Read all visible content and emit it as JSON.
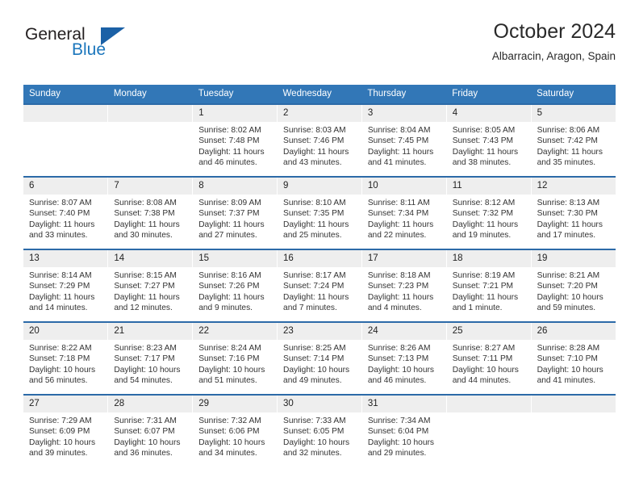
{
  "brand": {
    "name_part1": "General",
    "name_part2": "Blue",
    "accent_color": "#1b76bc",
    "triangle_color": "#1b61a6"
  },
  "header": {
    "title": "October 2024",
    "subtitle": "Albarracin, Aragon, Spain"
  },
  "theme": {
    "header_bg": "#3277b7",
    "row_rule": "#2c6aa8",
    "daynum_bg": "#eeeeee"
  },
  "weekdays": [
    "Sunday",
    "Monday",
    "Tuesday",
    "Wednesday",
    "Thursday",
    "Friday",
    "Saturday"
  ],
  "weeks": [
    [
      {
        "day": "",
        "sunrise": "",
        "sunset": "",
        "daylight": "",
        "empty": true
      },
      {
        "day": "",
        "sunrise": "",
        "sunset": "",
        "daylight": "",
        "empty": true
      },
      {
        "day": "1",
        "sunrise": "Sunrise: 8:02 AM",
        "sunset": "Sunset: 7:48 PM",
        "daylight": "Daylight: 11 hours and 46 minutes."
      },
      {
        "day": "2",
        "sunrise": "Sunrise: 8:03 AM",
        "sunset": "Sunset: 7:46 PM",
        "daylight": "Daylight: 11 hours and 43 minutes."
      },
      {
        "day": "3",
        "sunrise": "Sunrise: 8:04 AM",
        "sunset": "Sunset: 7:45 PM",
        "daylight": "Daylight: 11 hours and 41 minutes."
      },
      {
        "day": "4",
        "sunrise": "Sunrise: 8:05 AM",
        "sunset": "Sunset: 7:43 PM",
        "daylight": "Daylight: 11 hours and 38 minutes."
      },
      {
        "day": "5",
        "sunrise": "Sunrise: 8:06 AM",
        "sunset": "Sunset: 7:42 PM",
        "daylight": "Daylight: 11 hours and 35 minutes."
      }
    ],
    [
      {
        "day": "6",
        "sunrise": "Sunrise: 8:07 AM",
        "sunset": "Sunset: 7:40 PM",
        "daylight": "Daylight: 11 hours and 33 minutes."
      },
      {
        "day": "7",
        "sunrise": "Sunrise: 8:08 AM",
        "sunset": "Sunset: 7:38 PM",
        "daylight": "Daylight: 11 hours and 30 minutes."
      },
      {
        "day": "8",
        "sunrise": "Sunrise: 8:09 AM",
        "sunset": "Sunset: 7:37 PM",
        "daylight": "Daylight: 11 hours and 27 minutes."
      },
      {
        "day": "9",
        "sunrise": "Sunrise: 8:10 AM",
        "sunset": "Sunset: 7:35 PM",
        "daylight": "Daylight: 11 hours and 25 minutes."
      },
      {
        "day": "10",
        "sunrise": "Sunrise: 8:11 AM",
        "sunset": "Sunset: 7:34 PM",
        "daylight": "Daylight: 11 hours and 22 minutes."
      },
      {
        "day": "11",
        "sunrise": "Sunrise: 8:12 AM",
        "sunset": "Sunset: 7:32 PM",
        "daylight": "Daylight: 11 hours and 19 minutes."
      },
      {
        "day": "12",
        "sunrise": "Sunrise: 8:13 AM",
        "sunset": "Sunset: 7:30 PM",
        "daylight": "Daylight: 11 hours and 17 minutes."
      }
    ],
    [
      {
        "day": "13",
        "sunrise": "Sunrise: 8:14 AM",
        "sunset": "Sunset: 7:29 PM",
        "daylight": "Daylight: 11 hours and 14 minutes."
      },
      {
        "day": "14",
        "sunrise": "Sunrise: 8:15 AM",
        "sunset": "Sunset: 7:27 PM",
        "daylight": "Daylight: 11 hours and 12 minutes."
      },
      {
        "day": "15",
        "sunrise": "Sunrise: 8:16 AM",
        "sunset": "Sunset: 7:26 PM",
        "daylight": "Daylight: 11 hours and 9 minutes."
      },
      {
        "day": "16",
        "sunrise": "Sunrise: 8:17 AM",
        "sunset": "Sunset: 7:24 PM",
        "daylight": "Daylight: 11 hours and 7 minutes."
      },
      {
        "day": "17",
        "sunrise": "Sunrise: 8:18 AM",
        "sunset": "Sunset: 7:23 PM",
        "daylight": "Daylight: 11 hours and 4 minutes."
      },
      {
        "day": "18",
        "sunrise": "Sunrise: 8:19 AM",
        "sunset": "Sunset: 7:21 PM",
        "daylight": "Daylight: 11 hours and 1 minute."
      },
      {
        "day": "19",
        "sunrise": "Sunrise: 8:21 AM",
        "sunset": "Sunset: 7:20 PM",
        "daylight": "Daylight: 10 hours and 59 minutes."
      }
    ],
    [
      {
        "day": "20",
        "sunrise": "Sunrise: 8:22 AM",
        "sunset": "Sunset: 7:18 PM",
        "daylight": "Daylight: 10 hours and 56 minutes."
      },
      {
        "day": "21",
        "sunrise": "Sunrise: 8:23 AM",
        "sunset": "Sunset: 7:17 PM",
        "daylight": "Daylight: 10 hours and 54 minutes."
      },
      {
        "day": "22",
        "sunrise": "Sunrise: 8:24 AM",
        "sunset": "Sunset: 7:16 PM",
        "daylight": "Daylight: 10 hours and 51 minutes."
      },
      {
        "day": "23",
        "sunrise": "Sunrise: 8:25 AM",
        "sunset": "Sunset: 7:14 PM",
        "daylight": "Daylight: 10 hours and 49 minutes."
      },
      {
        "day": "24",
        "sunrise": "Sunrise: 8:26 AM",
        "sunset": "Sunset: 7:13 PM",
        "daylight": "Daylight: 10 hours and 46 minutes."
      },
      {
        "day": "25",
        "sunrise": "Sunrise: 8:27 AM",
        "sunset": "Sunset: 7:11 PM",
        "daylight": "Daylight: 10 hours and 44 minutes."
      },
      {
        "day": "26",
        "sunrise": "Sunrise: 8:28 AM",
        "sunset": "Sunset: 7:10 PM",
        "daylight": "Daylight: 10 hours and 41 minutes."
      }
    ],
    [
      {
        "day": "27",
        "sunrise": "Sunrise: 7:29 AM",
        "sunset": "Sunset: 6:09 PM",
        "daylight": "Daylight: 10 hours and 39 minutes."
      },
      {
        "day": "28",
        "sunrise": "Sunrise: 7:31 AM",
        "sunset": "Sunset: 6:07 PM",
        "daylight": "Daylight: 10 hours and 36 minutes."
      },
      {
        "day": "29",
        "sunrise": "Sunrise: 7:32 AM",
        "sunset": "Sunset: 6:06 PM",
        "daylight": "Daylight: 10 hours and 34 minutes."
      },
      {
        "day": "30",
        "sunrise": "Sunrise: 7:33 AM",
        "sunset": "Sunset: 6:05 PM",
        "daylight": "Daylight: 10 hours and 32 minutes."
      },
      {
        "day": "31",
        "sunrise": "Sunrise: 7:34 AM",
        "sunset": "Sunset: 6:04 PM",
        "daylight": "Daylight: 10 hours and 29 minutes."
      },
      {
        "day": "",
        "sunrise": "",
        "sunset": "",
        "daylight": "",
        "empty": true
      },
      {
        "day": "",
        "sunrise": "",
        "sunset": "",
        "daylight": "",
        "empty": true
      }
    ]
  ]
}
